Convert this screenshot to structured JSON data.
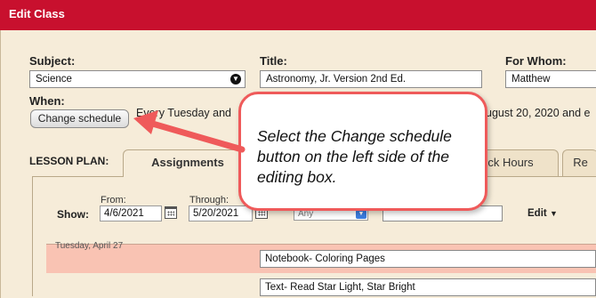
{
  "window": {
    "title": "Edit Class"
  },
  "form": {
    "subject": {
      "label": "Subject:",
      "value": "Science"
    },
    "title": {
      "label": "Title:",
      "value": "Astronomy, Jr. Version 2nd Ed."
    },
    "for_whom": {
      "label": "For Whom:",
      "value": "Matthew"
    },
    "when": {
      "label": "When:",
      "change_button": "Change schedule",
      "text_start": "Every Tuesday and",
      "text_end": "ugust 20, 2020 and e"
    }
  },
  "lesson_plan": {
    "label": "LESSON PLAN:",
    "tabs": [
      {
        "label": "Assignments",
        "active": true
      },
      {
        "label": "ck Hours",
        "active": false
      },
      {
        "label": "Re",
        "active": false
      }
    ],
    "show_label": "Show:",
    "from": {
      "label": "From:",
      "value": "4/6/2021"
    },
    "through": {
      "label": "Through:",
      "value": "5/20/2021"
    },
    "any_select": "Any",
    "edit_menu": "Edit",
    "rows": [
      {
        "date_label": "Tuesday, April 27",
        "assignment": "Notebook- Coloring Pages",
        "highlight": true
      },
      {
        "date_label": "",
        "assignment": "Text- Read Star Light, Star Bright",
        "highlight": false
      }
    ]
  },
  "callout": {
    "text": "Select the Change schedule button on the left side of the editing box."
  },
  "colors": {
    "title_bar": "#c8102e",
    "panel_bg": "#f6ecd9",
    "highlight_row": "#f9c3b3",
    "callout_border": "#ef5a5a",
    "arrow": "#ef5a5a"
  }
}
